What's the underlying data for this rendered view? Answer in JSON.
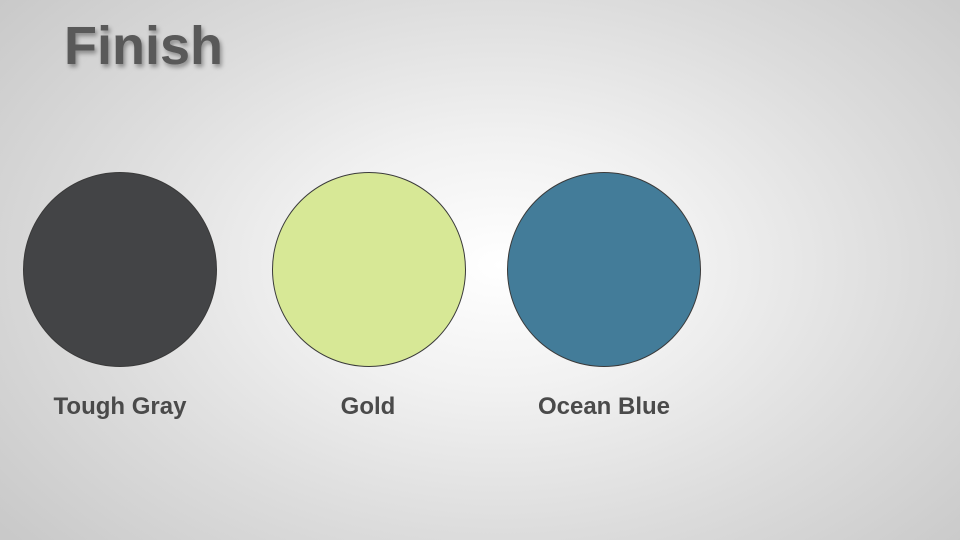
{
  "slide": {
    "title": "Finish"
  },
  "finishes": [
    {
      "label": "Tough Gray",
      "color": "#434446"
    },
    {
      "label": "Gold",
      "color": "#d7e896"
    },
    {
      "label": "Ocean Blue",
      "color": "#437c99"
    }
  ]
}
